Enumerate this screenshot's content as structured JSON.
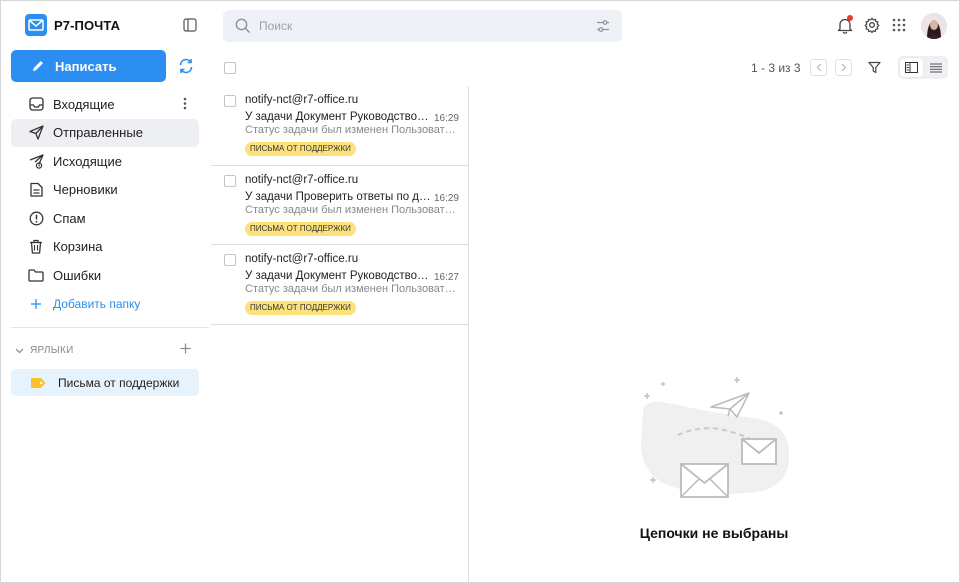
{
  "app": {
    "name": "Р7-ПОЧТА"
  },
  "compose": {
    "label": "Написать"
  },
  "folders": [
    {
      "label": "Входящие",
      "icon": "inbox-icon"
    },
    {
      "label": "Отправленные",
      "icon": "send-icon"
    },
    {
      "label": "Исходящие",
      "icon": "outbox-icon"
    },
    {
      "label": "Черновики",
      "icon": "draft-icon"
    },
    {
      "label": "Спам",
      "icon": "spam-icon"
    },
    {
      "label": "Корзина",
      "icon": "trash-icon"
    },
    {
      "label": "Ошибки",
      "icon": "folder-icon"
    }
  ],
  "add_folder": {
    "label": "Добавить папку"
  },
  "labels": {
    "title": "ЯРЛЫКИ",
    "items": [
      {
        "label": "Письма от поддержки",
        "color": "#fbc02d"
      }
    ]
  },
  "search": {
    "placeholder": "Поиск"
  },
  "toolbar": {
    "pager": "1 - 3 из 3"
  },
  "messages": [
    {
      "from": "notify-nct@r7-office.ru",
      "subject": "У задачи Документ Руководство Ад...",
      "time": "16:29",
      "preview": "Статус задачи был изменен Пользовател...",
      "tag": "ПИСЬМА ОТ ПОДДЕРЖКИ"
    },
    {
      "from": "notify-nct@r7-office.ru",
      "subject": "У задачи Проверить ответы по доку...",
      "time": "16:29",
      "preview": "Статус задачи был изменен Пользовател...",
      "tag": "ПИСЬМА ОТ ПОДДЕРЖКИ"
    },
    {
      "from": "notify-nct@r7-office.ru",
      "subject": "У задачи Документ Руководство Ад...",
      "time": "16:27",
      "preview": "Статус задачи был изменен Пользовател...",
      "tag": "ПИСЬМА ОТ ПОДДЕРЖКИ"
    }
  ],
  "empty_state": {
    "text": "Цепочки не выбраны"
  },
  "colors": {
    "accent": "#2b8ef0",
    "tag": "#fde27c",
    "notification": "#e53935"
  }
}
